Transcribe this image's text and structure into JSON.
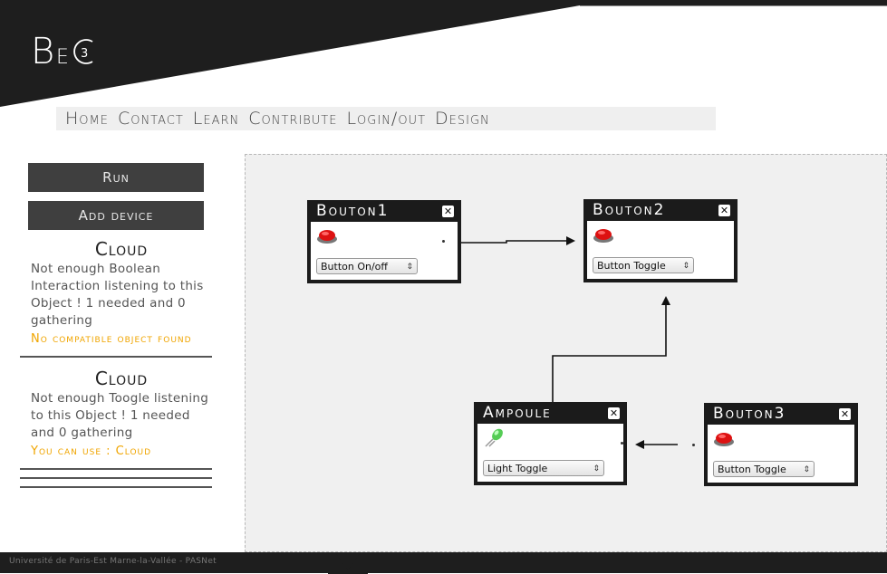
{
  "logo": {
    "text": "BE3"
  },
  "nav": {
    "items": [
      "Home",
      "Contact",
      "Learn",
      "Contribute",
      "Login/out",
      "Design"
    ]
  },
  "sidebar": {
    "run_label": "Run",
    "add_device_label": "Add device",
    "clouds": [
      {
        "title": "Cloud",
        "message": "Not enough Boolean Interaction listening to this Object ! 1 needed and 0 gathering",
        "hint": "No compatible object found"
      },
      {
        "title": "Cloud",
        "message": "Not enough Toogle listening to this Object ! 1 needed and 0 gathering",
        "hint": "You can use : Cloud"
      }
    ]
  },
  "devices": [
    {
      "id": "bouton1",
      "title": "Bouton1",
      "icon": "red-button-icon",
      "select_value": "Button On/off"
    },
    {
      "id": "bouton2",
      "title": "Bouton2",
      "icon": "red-button-icon",
      "select_value": "Button Toggle"
    },
    {
      "id": "ampoule",
      "title": "Ampoule",
      "icon": "green-led-icon",
      "select_value": "Light Toggle"
    },
    {
      "id": "bouton3",
      "title": "Bouton3",
      "icon": "red-button-icon",
      "select_value": "Button Toggle"
    }
  ],
  "footer": {
    "text": "Université de Paris-Est Marne-la-Vallée - PASNet"
  },
  "colors": {
    "accent": "#f0a500",
    "dark": "#1b1b1b",
    "canvas": "#f0f0f0"
  }
}
